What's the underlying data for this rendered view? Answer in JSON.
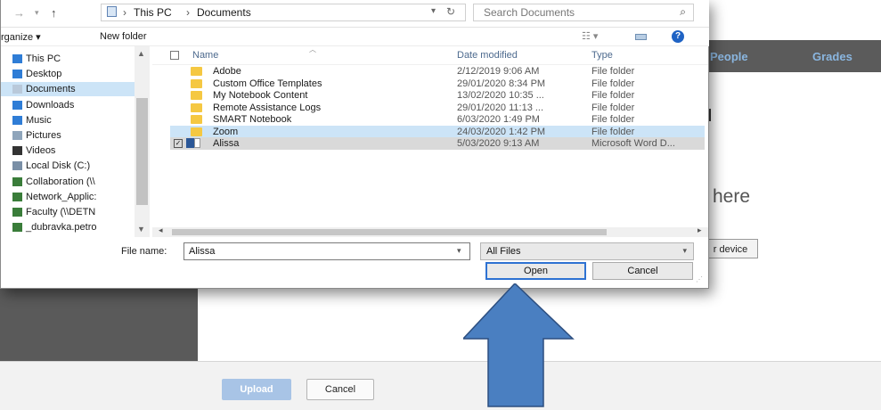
{
  "background_page": {
    "nav_tabs": [
      "People",
      "Grades"
    ],
    "drop_text": "here",
    "device_button": "r device",
    "upload_button": "Upload",
    "cancel_button": "Cancel"
  },
  "dialog": {
    "address_bar": {
      "crumbs": [
        "This PC",
        "Documents"
      ],
      "search_placeholder": "Search Documents"
    },
    "toolbar": {
      "organize": "rganize ▾",
      "new_folder": "New folder"
    },
    "nav_pane": [
      {
        "label": "This PC",
        "icon": "pc-icon",
        "color": "#2f7dd6"
      },
      {
        "label": "Desktop",
        "icon": "desktop-icon",
        "color": "#2f7dd6"
      },
      {
        "label": "Documents",
        "icon": "documents-icon",
        "color": "#b9c9da",
        "selected": true
      },
      {
        "label": "Downloads",
        "icon": "download-icon",
        "color": "#2f7dd6"
      },
      {
        "label": "Music",
        "icon": "music-icon",
        "color": "#2f7dd6"
      },
      {
        "label": "Pictures",
        "icon": "pictures-icon",
        "color": "#8fa5bb"
      },
      {
        "label": "Videos",
        "icon": "videos-icon",
        "color": "#333333"
      },
      {
        "label": "Local Disk (C:)",
        "icon": "disk-icon",
        "color": "#7a8fa6"
      },
      {
        "label": "Collaboration (\\\\",
        "icon": "network-drive-icon",
        "color": "#3a7d3a"
      },
      {
        "label": "Network_Applic:",
        "icon": "network-drive-icon",
        "color": "#3a7d3a"
      },
      {
        "label": "Faculty (\\\\DETN",
        "icon": "network-drive-icon",
        "color": "#3a7d3a"
      },
      {
        "label": "_dubravka.petro",
        "icon": "network-drive-icon",
        "color": "#3a7d3a"
      }
    ],
    "columns": {
      "name": "Name",
      "date": "Date modified",
      "type": "Type"
    },
    "files": [
      {
        "name": "Adobe",
        "date": "2/12/2019 9:06 AM",
        "type": "File folder",
        "kind": "folder"
      },
      {
        "name": "Custom Office Templates",
        "date": "29/01/2020 8:34 PM",
        "type": "File folder",
        "kind": "folder"
      },
      {
        "name": "My Notebook Content",
        "date": "13/02/2020 10:35 ...",
        "type": "File folder",
        "kind": "folder"
      },
      {
        "name": "Remote Assistance Logs",
        "date": "29/01/2020 11:13 ...",
        "type": "File folder",
        "kind": "folder"
      },
      {
        "name": "SMART Notebook",
        "date": "6/03/2020 1:49 PM",
        "type": "File folder",
        "kind": "folder"
      },
      {
        "name": "Zoom",
        "date": "24/03/2020 1:42 PM",
        "type": "File folder",
        "kind": "folder",
        "highlight": "hover"
      },
      {
        "name": "Alissa",
        "date": "5/03/2020 9:13 AM",
        "type": "Microsoft Word D...",
        "kind": "word",
        "highlight": "selected"
      }
    ],
    "file_name_label": "File name:",
    "file_name_value": "Alissa",
    "file_type": "All Files",
    "open_button": "Open",
    "cancel_button": "Cancel"
  },
  "colors": {
    "arrow_fill": "#4a7fc1",
    "arrow_stroke": "#2d4f80",
    "accent": "#2e72d2"
  }
}
